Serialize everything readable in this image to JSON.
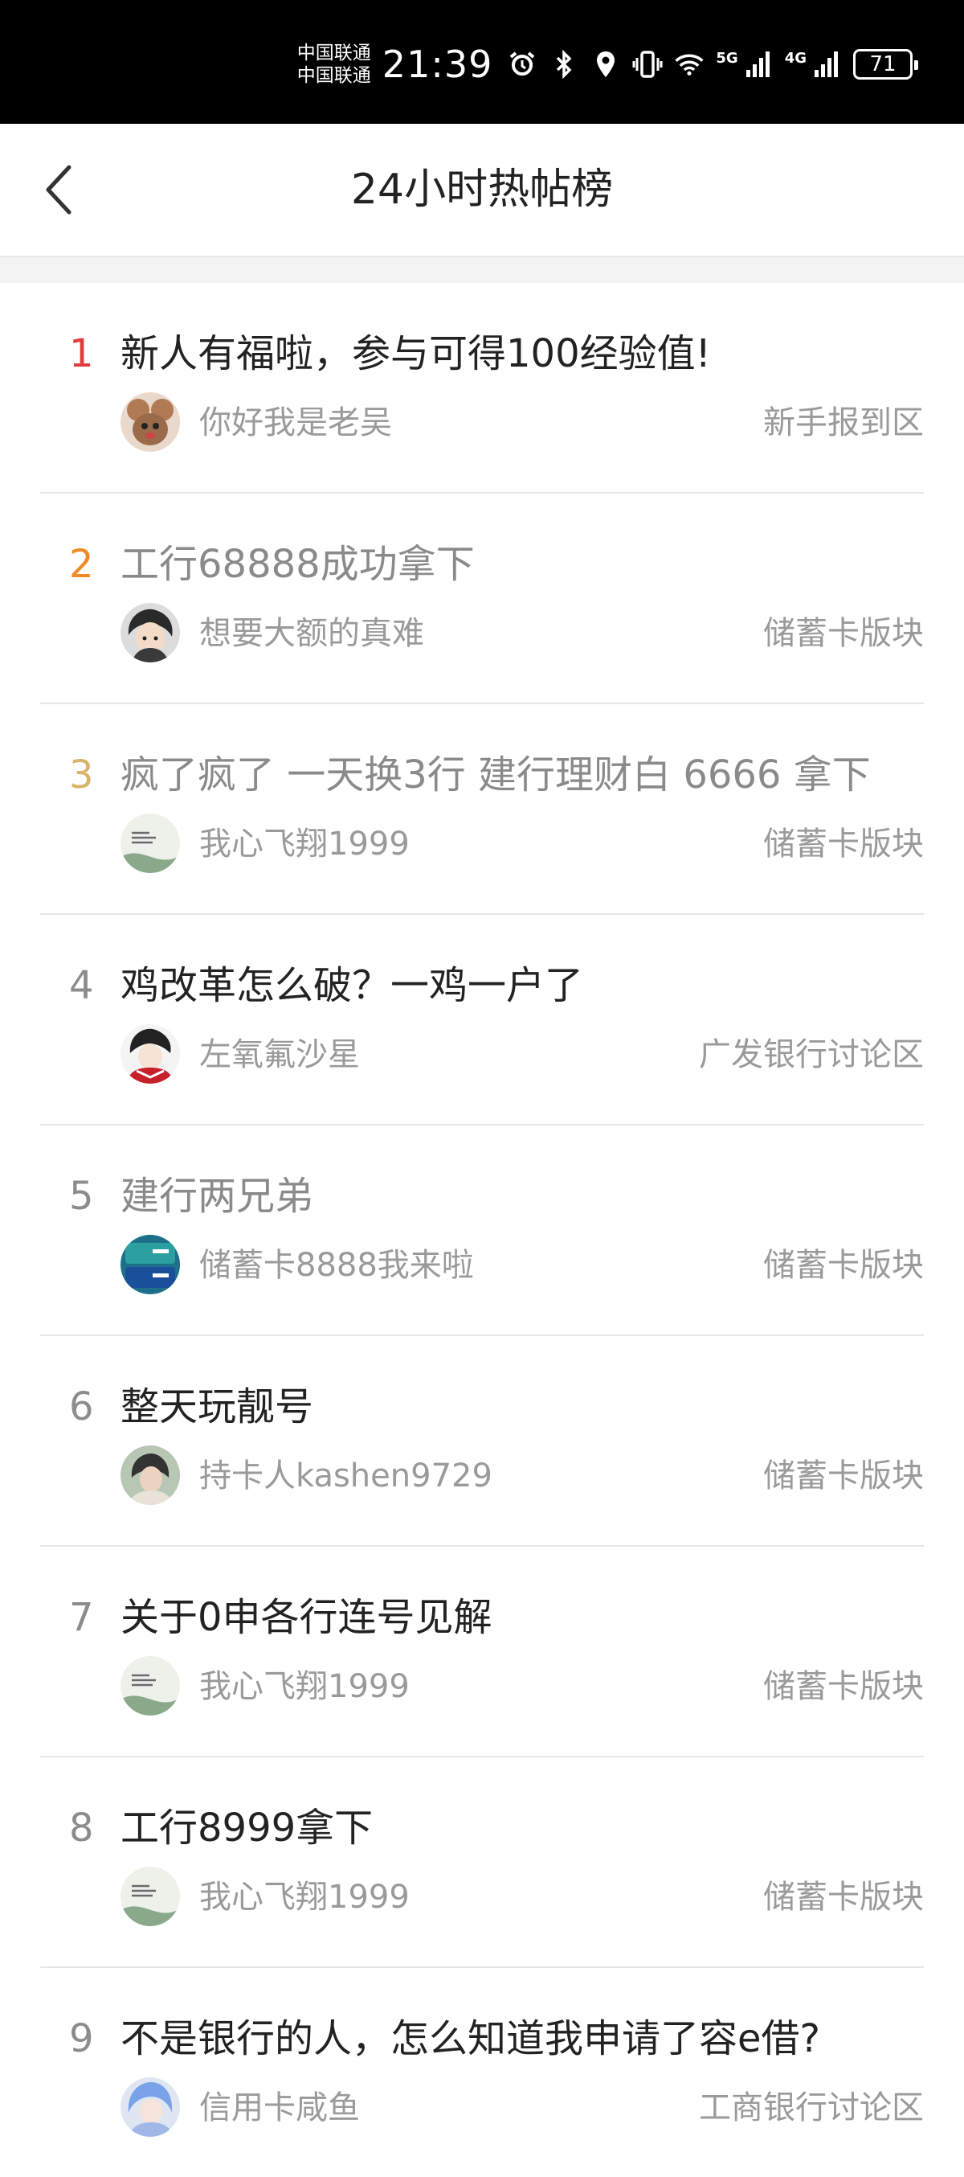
{
  "status_bar": {
    "carrier1": "中国联通",
    "carrier2": "中国联通",
    "time": "21:39",
    "net1": "5G",
    "net2": "4G",
    "battery": "71",
    "icons": [
      "alarm-icon",
      "bluetooth-icon",
      "location-icon",
      "vibrate-icon",
      "wifi-icon",
      "signal-5g-icon",
      "signal-4g-icon",
      "battery-icon"
    ]
  },
  "nav": {
    "title": "24小时热帖榜",
    "back_icon": "chevron-left-icon"
  },
  "colors": {
    "rank1": "#e03c3c",
    "rank2": "#f08a24",
    "rank3": "#d9b36a",
    "rank_default": "#8c8c8c",
    "title": "#222222",
    "read_title": "#8a8a8a",
    "meta": "#9a9a9a"
  },
  "posts": [
    {
      "rank": "1",
      "title": "新人有福啦，参与可得100经验值!",
      "author": "你好我是老吴",
      "board": "新手报到区",
      "read": false,
      "avatar": "avatar-cartoon-mouse"
    },
    {
      "rank": "2",
      "title": "工行68888成功拿下",
      "author": "想要大额的真难",
      "board": "储蓄卡版块",
      "read": true,
      "avatar": "avatar-anime-boy"
    },
    {
      "rank": "3",
      "title": "疯了疯了 一天换3行  建行理财白 6666 拿下",
      "author": "我心飞翔1999",
      "board": "储蓄卡版块",
      "read": true,
      "avatar": "avatar-ink-painting"
    },
    {
      "rank": "4",
      "title": "鸡改革怎么破？一鸡一户了",
      "author": "左氧氟沙星",
      "board": "广发银行讨论区",
      "read": false,
      "avatar": "avatar-anime-girl"
    },
    {
      "rank": "5",
      "title": "建行两兄弟",
      "author": "储蓄卡8888我来啦",
      "board": "储蓄卡版块",
      "read": true,
      "avatar": "avatar-bank-card"
    },
    {
      "rank": "6",
      "title": "整天玩靓号",
      "author": "持卡人kashen9729",
      "board": "储蓄卡版块",
      "read": false,
      "avatar": "avatar-photo"
    },
    {
      "rank": "7",
      "title": "关于0申各行连号见解",
      "author": "我心飞翔1999",
      "board": "储蓄卡版块",
      "read": false,
      "avatar": "avatar-ink-painting"
    },
    {
      "rank": "8",
      "title": "工行8999拿下",
      "author": "我心飞翔1999",
      "board": "储蓄卡版块",
      "read": false,
      "avatar": "avatar-ink-painting"
    },
    {
      "rank": "9",
      "title": "不是银行的人，怎么知道我申请了容e借?",
      "author": "信用卡咸鱼",
      "board": "工商银行讨论区",
      "read": false,
      "avatar": "avatar-anime-blue-hair"
    }
  ]
}
